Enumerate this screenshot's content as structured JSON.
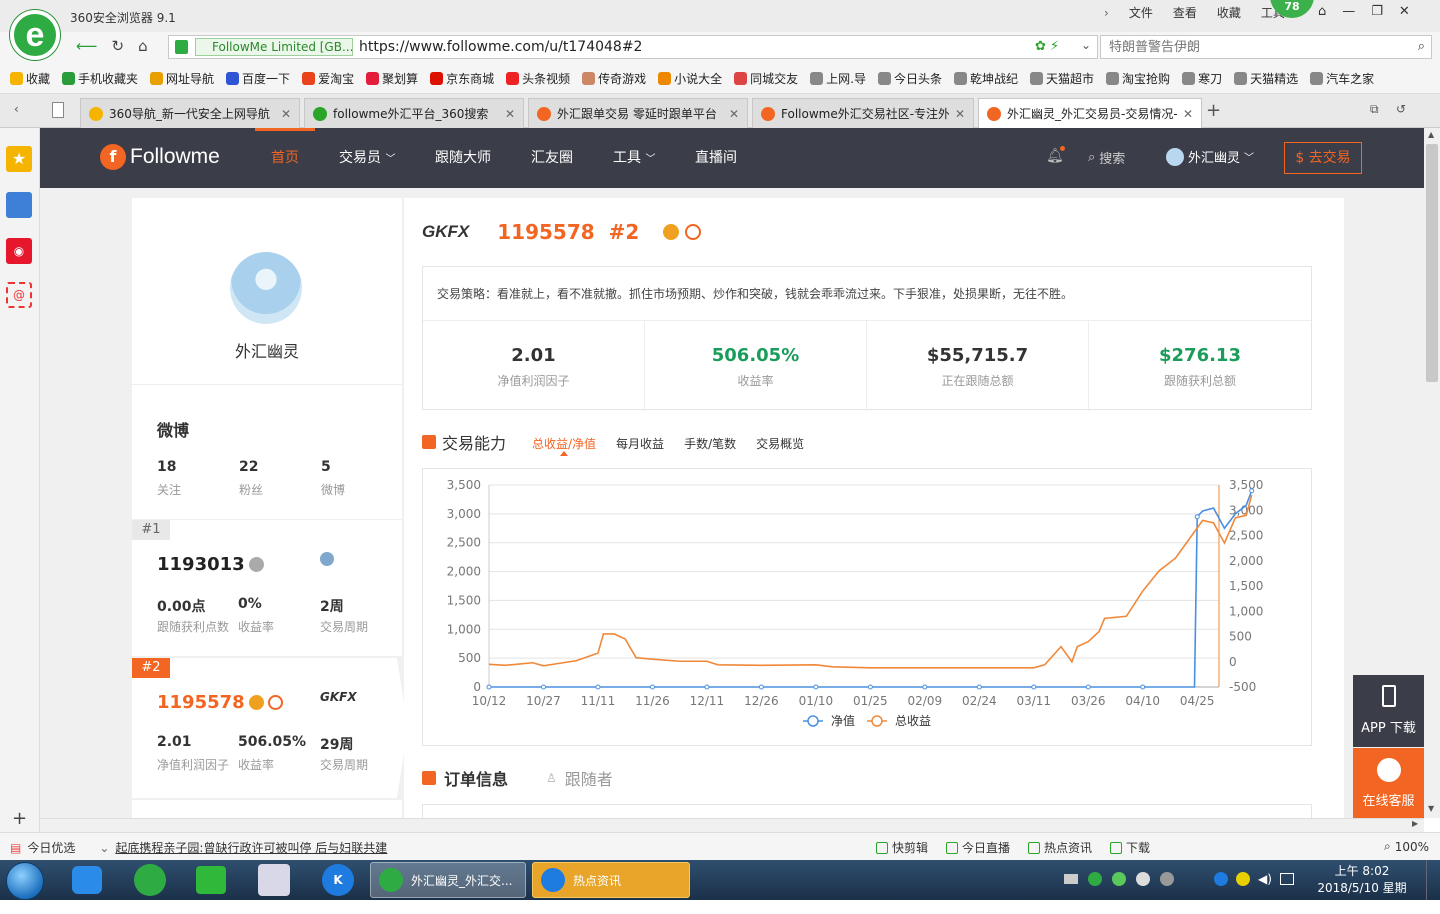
{
  "browser": {
    "title": "360安全浏览器 9.1",
    "menu": [
      "文件",
      "查看",
      "收藏",
      "工具"
    ],
    "badge": "78",
    "cert": "FollowMe Limited [GB...",
    "url": "https://www.followme.com/u/t174048#2",
    "search_placeholder": "特朗普警告伊朗"
  },
  "bookmarks": [
    {
      "label": "收藏",
      "color": "#f5b400"
    },
    {
      "label": "手机收藏夹",
      "color": "#2a9d3a"
    },
    {
      "label": "网址导航",
      "color": "#e8a000"
    },
    {
      "label": "百度一下",
      "color": "#2f55d4"
    },
    {
      "label": "爱淘宝",
      "color": "#e8431b"
    },
    {
      "label": "聚划算",
      "color": "#e31d3c"
    },
    {
      "label": "京东商城",
      "color": "#d10"
    },
    {
      "label": "头条视频",
      "color": "#e22"
    },
    {
      "label": "传奇游戏",
      "color": "#c86"
    },
    {
      "label": "小说大全",
      "color": "#e80"
    },
    {
      "label": "同城交友",
      "color": "#d44"
    },
    {
      "label": "上网.导",
      "color": "#888"
    },
    {
      "label": "今日头条",
      "color": "#888"
    },
    {
      "label": "乾坤战纪",
      "color": "#888"
    },
    {
      "label": "天猫超市",
      "color": "#888"
    },
    {
      "label": "淘宝抢购",
      "color": "#888"
    },
    {
      "label": "寒刀",
      "color": "#888"
    },
    {
      "label": "天猫精选",
      "color": "#888"
    },
    {
      "label": "汽车之家",
      "color": "#888"
    }
  ],
  "tabs": [
    {
      "label": "360导航_新一代安全上网导航",
      "color": "#f5b400"
    },
    {
      "label": "followme外汇平台_360搜索",
      "color": "#2aa52a"
    },
    {
      "label": "外汇跟单交易 零延时跟单平台",
      "color": "#f26522"
    },
    {
      "label": "Followme外汇交易社区-专注外汇",
      "color": "#f26522"
    },
    {
      "label": "外汇幽灵_外汇交易员-交易情况-F",
      "color": "#f26522"
    }
  ],
  "site": {
    "logo": "Followme",
    "nav": [
      "首页",
      "交易员",
      "跟随大师",
      "汇友圈",
      "工具",
      "直播间"
    ],
    "search": "搜索",
    "user": "外汇幽灵",
    "trade_btn": "$ 去交易"
  },
  "profile": {
    "name": "外汇幽灵",
    "weibo_title": "微博",
    "weibo_stats": [
      {
        "value": "18",
        "label": "关注"
      },
      {
        "value": "22",
        "label": "粉丝"
      },
      {
        "value": "5",
        "label": "微博"
      }
    ],
    "accounts": [
      {
        "rank": "#1",
        "id": "1193013",
        "stats": [
          {
            "value": "0.00点",
            "label": "跟随获利点数"
          },
          {
            "value": "0%",
            "label": "收益率"
          },
          {
            "value": "2周",
            "label": "交易周期"
          }
        ]
      },
      {
        "rank": "#2",
        "id": "1195578",
        "broker": "GKFX",
        "stats": [
          {
            "value": "2.01",
            "label": "净值利润因子"
          },
          {
            "value": "506.05%",
            "label": "收益率"
          },
          {
            "value": "29周",
            "label": "交易周期"
          }
        ]
      }
    ]
  },
  "main": {
    "broker": "GKFX",
    "account_id": "1195578",
    "rank": "#2",
    "strategy": "交易策略：看准就上，看不准就撤。抓住市场预期、炒作和突破，钱就会乖乖流过来。下手狠准，处损果断，无往不胜。",
    "stats": [
      {
        "value": "2.01",
        "label": "净值利润因子",
        "color": "#333"
      },
      {
        "value": "506.05%",
        "label": "收益率",
        "color": "#1a9c5a"
      },
      {
        "value": "$55,715.7",
        "label": "正在跟随总额",
        "color": "#333"
      },
      {
        "value": "$276.13",
        "label": "跟随获利总额",
        "color": "#1a9c5a"
      }
    ],
    "section_title": "交易能力",
    "chart_tabs": [
      "总收益/净值",
      "每月收益",
      "手数/笔数",
      "交易概览"
    ],
    "order_title": "订单信息",
    "follower_title": "跟随者"
  },
  "chart_data": {
    "type": "line",
    "x_ticks": [
      "10/12",
      "10/27",
      "11/11",
      "11/26",
      "12/11",
      "12/26",
      "01/10",
      "01/25",
      "02/09",
      "02/24",
      "03/11",
      "03/26",
      "04/10",
      "04/25"
    ],
    "left_axis": {
      "ticks": [
        0,
        500,
        1000,
        1500,
        2000,
        2500,
        3000,
        3500
      ],
      "range": [
        0,
        3500
      ]
    },
    "right_axis": {
      "ticks": [
        -500,
        0,
        500,
        1000,
        1500,
        2000,
        2500,
        3000,
        3500
      ],
      "range": [
        -500,
        3500
      ]
    },
    "series": [
      {
        "name": "净值",
        "color": "#4a90e2",
        "axis": "left",
        "points": [
          [
            0,
            0
          ],
          [
            1,
            0
          ],
          [
            2,
            0
          ],
          [
            3,
            0
          ],
          [
            4,
            0
          ],
          [
            5,
            0
          ],
          [
            6,
            0
          ],
          [
            7,
            0
          ],
          [
            8,
            0
          ],
          [
            9,
            0
          ],
          [
            10,
            0
          ],
          [
            11,
            0
          ],
          [
            12,
            0
          ],
          [
            12.95,
            0
          ],
          [
            13.0,
            2950
          ],
          [
            13.1,
            3050
          ],
          [
            13.3,
            3100
          ],
          [
            13.5,
            2750
          ],
          [
            13.7,
            3000
          ],
          [
            13.9,
            3150
          ],
          [
            14.0,
            3400
          ]
        ]
      },
      {
        "name": "总收益",
        "color": "#f0883a",
        "axis": "right",
        "points": [
          [
            0,
            -50
          ],
          [
            0.3,
            -70
          ],
          [
            0.5,
            -50
          ],
          [
            0.8,
            -20
          ],
          [
            1,
            -80
          ],
          [
            1.3,
            -30
          ],
          [
            1.6,
            20
          ],
          [
            2,
            170
          ],
          [
            2.1,
            550
          ],
          [
            2.3,
            550
          ],
          [
            2.5,
            450
          ],
          [
            2.7,
            80
          ],
          [
            3,
            50
          ],
          [
            3.5,
            10
          ],
          [
            4,
            10
          ],
          [
            4.2,
            -60
          ],
          [
            5,
            -70
          ],
          [
            6,
            -60
          ],
          [
            6.3,
            -100
          ],
          [
            7,
            -120
          ],
          [
            8,
            -120
          ],
          [
            9,
            -120
          ],
          [
            10,
            -120
          ],
          [
            10.2,
            -60
          ],
          [
            10.5,
            300
          ],
          [
            10.7,
            0
          ],
          [
            10.8,
            300
          ],
          [
            11,
            400
          ],
          [
            11.2,
            600
          ],
          [
            11.3,
            860
          ],
          [
            11.7,
            900
          ],
          [
            12,
            1400
          ],
          [
            12.3,
            1800
          ],
          [
            12.6,
            2050
          ],
          [
            12.9,
            2500
          ],
          [
            13.1,
            2800
          ],
          [
            13.3,
            2750
          ],
          [
            13.5,
            2350
          ],
          [
            13.7,
            2850
          ],
          [
            13.9,
            2900
          ],
          [
            14.0,
            3300
          ]
        ]
      }
    ]
  },
  "right_widgets": {
    "app": "APP 下载",
    "service": "在线客服"
  },
  "statusbar": {
    "left": "今日优选",
    "news": "起底携程亲子园:曾缺行政许可被叫停 后与妇联共建",
    "items": [
      "快剪辑",
      "今日直播",
      "热点资讯",
      "下载"
    ],
    "zoom": "100%"
  },
  "taskbar": {
    "windows": [
      "外汇幽灵_外汇交...",
      "热点资讯"
    ],
    "time": "上午 8:02",
    "date": "2018/5/10 星期四"
  }
}
